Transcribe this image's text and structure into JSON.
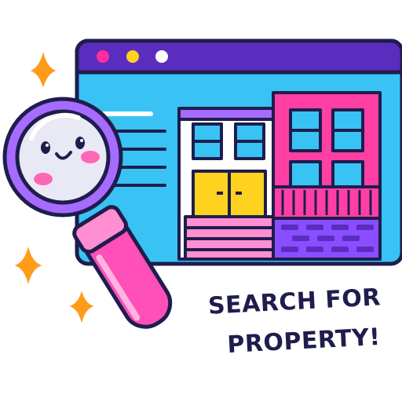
{
  "illustration": {
    "icons": [
      "browser-window-icon",
      "magnifying-glass-icon",
      "building-icon",
      "sparkle-icon"
    ],
    "colors": {
      "outline": "#1f1d4d",
      "title_bar": "#5b2dbe",
      "window_body": "#39c3f5",
      "dot_pink": "#ff2e9a",
      "dot_yellow": "#ffd21f",
      "dot_white": "#ffffff",
      "building_pink": "#ff3fa4",
      "building_white": "#ffffff",
      "door_yellow": "#ffd21f",
      "brick_purple": "#8a4dff",
      "lens_rim": "#a66bff",
      "handle_pink": "#ff4fb8",
      "sparkle_orange": "#ff9b1a"
    }
  },
  "caption": {
    "line1": "SEARCH FOR",
    "line2": "PROPERTY!"
  }
}
